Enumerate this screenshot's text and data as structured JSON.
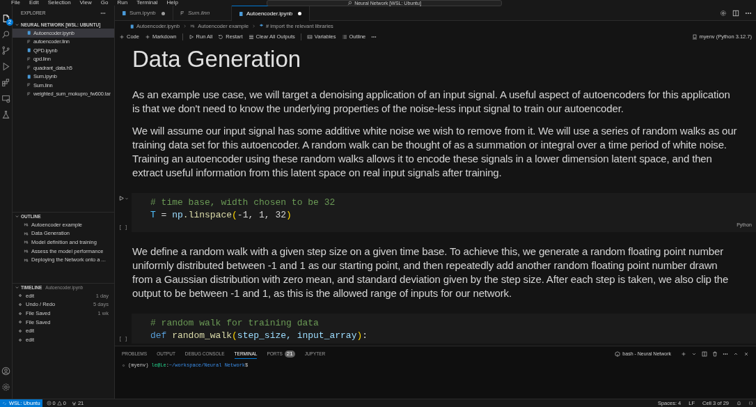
{
  "menu": [
    "File",
    "Edit",
    "Selection",
    "View",
    "Go",
    "Run",
    "Terminal",
    "Help"
  ],
  "command_center": "Neural Network [WSL: Ubuntu]",
  "explorer": {
    "title": "EXPLORER",
    "badge": "2",
    "root": "NEURAL NETWORK [WSL: UBUNTU]",
    "files": [
      {
        "name": "Autoencoder.ipynb",
        "kind": "notebook",
        "selected": true
      },
      {
        "name": "autoencoder.linn",
        "kind": "file",
        "selected": false
      },
      {
        "name": "QPD.ipynb",
        "kind": "notebook",
        "selected": false
      },
      {
        "name": "qpd.linn",
        "kind": "file",
        "selected": false
      },
      {
        "name": "quadrant_data.h5",
        "kind": "file",
        "selected": false
      },
      {
        "name": "Sum.ipynb",
        "kind": "notebook",
        "selected": false
      },
      {
        "name": "Sum.linn",
        "kind": "file",
        "selected": false
      },
      {
        "name": "weighted_sum_mokupro_fw600.tar",
        "kind": "file",
        "selected": false
      }
    ]
  },
  "outline": {
    "title": "OUTLINE",
    "items": [
      "Autoencoder example",
      "Data Generation",
      "Model definition and training",
      "Assess the model performance",
      "Deploying the Network onto a ..."
    ]
  },
  "timeline": {
    "title": "TIMELINE",
    "file": "Autoencoder.ipynb",
    "items": [
      {
        "label": "edit",
        "time": "1 day"
      },
      {
        "label": "Undo / Redo",
        "time": "5 days"
      },
      {
        "label": "File Saved",
        "time": "1 wk"
      },
      {
        "label": "File Saved"
      },
      {
        "label": "edit"
      },
      {
        "label": "edit"
      }
    ]
  },
  "tabs": [
    {
      "label": "Sum.ipynb",
      "kind": "notebook",
      "selected": false,
      "modified": true,
      "preview": false
    },
    {
      "label": "Sum.linn",
      "kind": "file",
      "selected": false,
      "modified": false,
      "preview": true
    },
    {
      "label": "Autoencoder.ipynb",
      "kind": "notebook",
      "selected": true,
      "modified": true,
      "preview": false
    }
  ],
  "breadcrumb": [
    "Autoencoder.ipynb",
    "Autoencoder example",
    "# import the relevant libraries"
  ],
  "toolbar": [
    {
      "label": "Code",
      "kind": "plus"
    },
    {
      "label": "Markdown",
      "kind": "plus"
    },
    {
      "label": "Run All",
      "kind": "run"
    },
    {
      "label": "Restart",
      "kind": "restart"
    },
    {
      "label": "Clear All Outputs",
      "kind": "clear"
    },
    {
      "label": "Variables",
      "kind": "variables"
    },
    {
      "label": "Outline",
      "kind": "outline"
    }
  ],
  "kernel": "myenv (Python 3.12.7)",
  "cells": [
    {
      "kind": "heading",
      "text": "Data Generation"
    },
    {
      "kind": "markdown",
      "lines": [
        "As an example use case, we will target a denoising application of an input signal. A useful aspect of autoencoders for this application",
        "is that we don't need to know the underlying properties of the noise-less input signal to train our autoencoder."
      ]
    },
    {
      "kind": "markdown",
      "lines": [
        "We will assume our input signal has some additive white noise we wish to remove from it. We will use a series of random walks as our",
        "training data set for this autoencoder. A random walk can be thought of as a summation or integral over a time period of white noise.",
        "Training an autoencoder using these random walks allows it to encode these signals in a lower dimension latent space, and then",
        "extract useful information from this latent space on real input signals after training."
      ]
    },
    {
      "kind": "code",
      "execution": "[ ]",
      "language": "Python",
      "lines": [
        [
          {
            "text": "# time base, width chosen to be 32",
            "kind": "comment"
          }
        ],
        [
          {
            "text": "T",
            "kind": "const"
          },
          {
            "text": " = ",
            "kind": "op"
          },
          {
            "text": "np",
            "kind": "var"
          },
          {
            "text": ".linspace",
            "kind": "fn"
          },
          {
            "text": "(",
            "kind": "paren"
          },
          {
            "text": "-1, 1, 32",
            "kind": "num"
          },
          {
            "text": ")",
            "kind": "paren"
          }
        ]
      ]
    },
    {
      "kind": "markdown",
      "lines": [
        "We define a random walk with a given step size on a given time base. To achieve this, we generate a random floating point number",
        "uniformly distributed between -1 and 1 as our starting point, and then repeatedly add another random floating point number drawn",
        "from a Gaussian distribution with zero mean, and standard deviation given by the step size. After each step is taken, we also clip the",
        "output to be between -1 and 1, as this is the allowed range of inputs for our network."
      ]
    },
    {
      "kind": "code",
      "execution": "[ ]",
      "lines": [
        [
          {
            "text": "# random walk for training data",
            "kind": "comment"
          }
        ],
        [
          {
            "text": "def",
            "kind": "keyword"
          },
          {
            "text": " random_walk",
            "kind": "fn"
          },
          {
            "text": "(",
            "kind": "paren"
          },
          {
            "text": "step_size, input_array",
            "kind": "var"
          },
          {
            "text": ")",
            "kind": "paren"
          },
          {
            "text": ":",
            "kind": "op"
          }
        ]
      ]
    }
  ],
  "panel": {
    "tabs": [
      {
        "label": "PROBLEMS",
        "selected": false
      },
      {
        "label": "OUTPUT",
        "selected": false
      },
      {
        "label": "DEBUG CONSOLE",
        "selected": false
      },
      {
        "label": "TERMINAL",
        "selected": true
      },
      {
        "label": "PORTS",
        "selected": false,
        "badge": "21"
      },
      {
        "label": "JUPYTER",
        "selected": false
      }
    ],
    "terminal_name": "bash - Neural Network",
    "prompt": [
      {
        "text": "(myenv) ",
        "kind": "env"
      },
      {
        "text": "le@Le",
        "kind": "user"
      },
      {
        "text": ":",
        "kind": "sep"
      },
      {
        "text": "~/workspace/Neural Network",
        "kind": "path"
      },
      {
        "text": "$",
        "kind": "sep"
      }
    ]
  },
  "status_bar": {
    "remote": "WSL: Ubuntu",
    "errors": "0",
    "warnings": "0",
    "ports": "21",
    "right": [
      "Spaces: 4",
      "LF",
      "Cell 3 of 29"
    ]
  }
}
